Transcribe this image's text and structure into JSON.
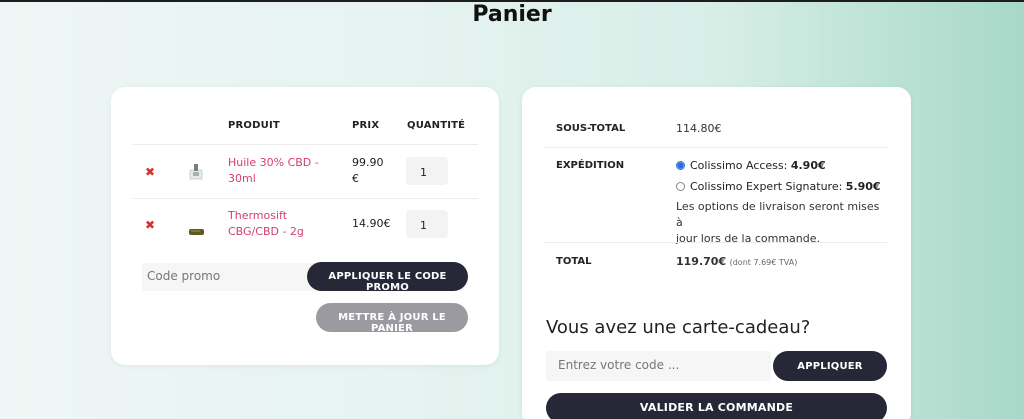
{
  "page": {
    "title": "Panier"
  },
  "cart": {
    "headers": {
      "product": "PRODUIT",
      "price": "PRIX",
      "quantity": "QUANTITÉ"
    },
    "items": [
      {
        "name_line1": "Huile 30% CBD -",
        "name_line2": "30ml",
        "price_line1": "99.90",
        "price_line2": "€",
        "qty": "1"
      },
      {
        "name_line1": "Thermosift",
        "name_line2": "CBG/CBD - 2g",
        "price_line1": "14.90€",
        "price_line2": "",
        "qty": "1"
      }
    ],
    "remove_symbol": "✖",
    "promo_placeholder": "Code promo",
    "apply_promo_label": "APPLIQUER LE CODE PROMO",
    "update_cart_label": "METTRE À JOUR LE PANIER"
  },
  "totals": {
    "subtotal_label": "SOUS-TOTAL",
    "subtotal_value": "114.80€",
    "shipping_label": "EXPÉDITION",
    "shipping_options": [
      {
        "name": "Colissimo Access: ",
        "price": "4.90€",
        "selected": true
      },
      {
        "name": "Colissimo Expert Signature: ",
        "price": "5.90€",
        "selected": false
      }
    ],
    "shipping_note_line1": "Les options de livraison seront mises à",
    "shipping_note_line2": "jour lors de la commande.",
    "total_label": "TOTAL",
    "total_value": "119.70€",
    "total_tax": "(dont 7.69€ TVA)"
  },
  "gift": {
    "title": "Vous avez une carte-cadeau?",
    "placeholder": "Entrez votre code ...",
    "apply_label": "APPLIQUER"
  },
  "checkout_label": "VALIDER LA COMMANDE"
}
